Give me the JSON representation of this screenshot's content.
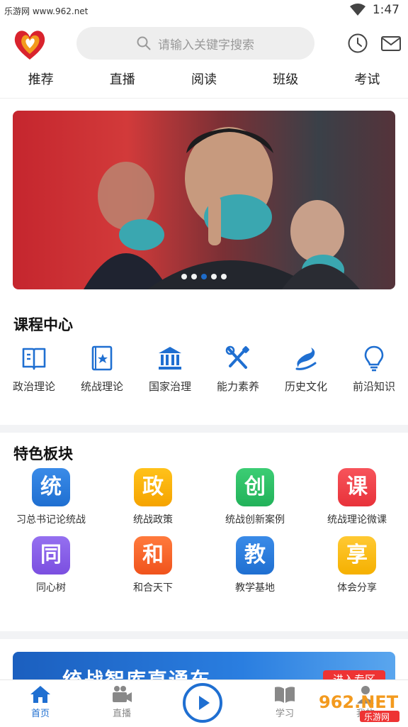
{
  "status_bar": {
    "watermark": "乐游网 www.962.net",
    "time": "1:47"
  },
  "header": {
    "search_placeholder": "请输入关键字搜索"
  },
  "tabs": [
    {
      "label": "推荐"
    },
    {
      "label": "直播"
    },
    {
      "label": "阅读"
    },
    {
      "label": "班级"
    },
    {
      "label": "考试"
    }
  ],
  "banner": {
    "dot_count": 5,
    "active_dot": 3
  },
  "course_center": {
    "title": "课程中心",
    "items": [
      {
        "label": "政治理论",
        "icon": "book-icon"
      },
      {
        "label": "统战理论",
        "icon": "star-book-icon"
      },
      {
        "label": "国家治理",
        "icon": "building-icon"
      },
      {
        "label": "能力素养",
        "icon": "tools-icon"
      },
      {
        "label": "历史文化",
        "icon": "dragon-icon"
      },
      {
        "label": "前沿知识",
        "icon": "lightbulb-icon"
      }
    ]
  },
  "features": {
    "title": "特色板块",
    "items": [
      {
        "char": "统",
        "label": "习总书记论统战",
        "color": "#1f6fd1"
      },
      {
        "char": "政",
        "label": "统战政策",
        "color": "#f5a300"
      },
      {
        "char": "创",
        "label": "统战创新案例",
        "color": "#22b25a"
      },
      {
        "char": "课",
        "label": "统战理论微课",
        "color": "#e8323a"
      },
      {
        "char": "同",
        "label": "同心树",
        "color": "#7b4fe0"
      },
      {
        "char": "和",
        "label": "和合天下",
        "color": "#f0531c"
      },
      {
        "char": "教",
        "label": "教学基地",
        "color": "#1f6fd1"
      },
      {
        "char": "享",
        "label": "体会分享",
        "color": "#f5b000"
      }
    ]
  },
  "promo": {
    "title": "统战智库直通车",
    "button": "进入专区"
  },
  "bottom_nav": [
    {
      "label": "首页",
      "icon": "home-icon",
      "active": true
    },
    {
      "label": "直播",
      "icon": "video-icon"
    },
    {
      "label": "",
      "icon": "play-icon"
    },
    {
      "label": "学习",
      "icon": "open-book-icon"
    },
    {
      "label": "我的",
      "icon": "person-icon"
    }
  ],
  "overlay_watermark": {
    "logo_text": "962.NET",
    "sub_text": "乐游网"
  },
  "colors": {
    "accent": "#1f6fd1",
    "logo_red": "#d9232d",
    "logo_orange": "#f39a1e"
  }
}
